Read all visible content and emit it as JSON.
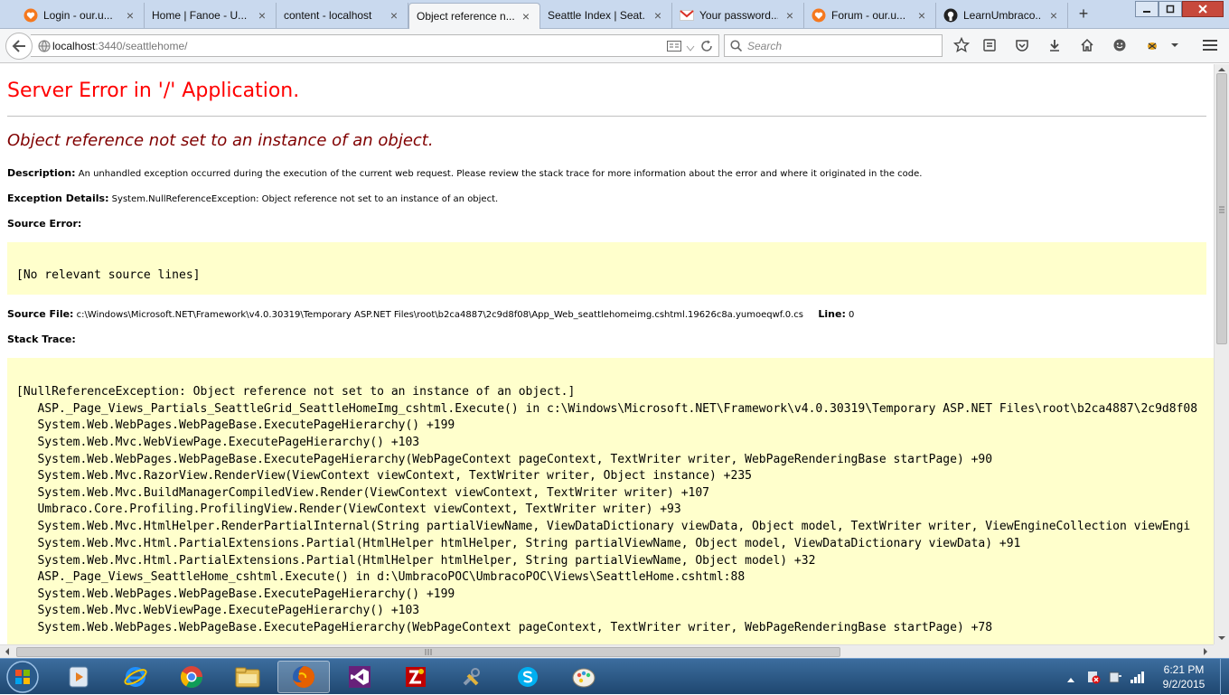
{
  "browser": {
    "tabs": [
      {
        "label": "Login - our.u...",
        "icon": "umbraco-heart-icon",
        "active": false
      },
      {
        "label": "Home | Fanoe - U...",
        "icon": "none",
        "active": false
      },
      {
        "label": "content - localhost",
        "icon": "none",
        "active": false
      },
      {
        "label": "Object reference n...",
        "icon": "none",
        "active": true
      },
      {
        "label": "Seattle Index | Seat...",
        "icon": "none",
        "active": false
      },
      {
        "label": "Your password...",
        "icon": "gmail-icon",
        "active": false
      },
      {
        "label": "Forum - our.u...",
        "icon": "umbraco-heart-icon",
        "active": false
      },
      {
        "label": "LearnUmbraco...",
        "icon": "github-icon",
        "active": false
      }
    ],
    "new_tab": "+",
    "close_glyph": "×",
    "url_host": "localhost",
    "url_path": ":3440/seattlehome/",
    "search_placeholder": "Search"
  },
  "error_page": {
    "title": "Server Error in '/' Application.",
    "message": "Object reference not set to an instance of an object.",
    "description_label": "Description:",
    "description_text": "An unhandled exception occurred during the execution of the current web request. Please review the stack trace for more information about the error and where it originated in the code.",
    "exception_label": "Exception Details:",
    "exception_text": "System.NullReferenceException: Object reference not set to an instance of an object.",
    "source_error_label": "Source Error:",
    "source_error_text": "[No relevant source lines]",
    "source_file_label": "Source File:",
    "source_file_text": "c:\\Windows\\Microsoft.NET\\Framework\\v4.0.30319\\Temporary ASP.NET Files\\root\\b2ca4887\\2c9d8f08\\App_Web_seattlehomeimg.cshtml.19626c8a.yumoeqwf.0.cs",
    "line_label": "Line:",
    "line_value": "0",
    "stack_trace_label": "Stack Trace:",
    "stack_trace_lines": [
      "[NullReferenceException: Object reference not set to an instance of an object.]",
      "   ASP._Page_Views_Partials_SeattleGrid_SeattleHomeImg_cshtml.Execute() in c:\\Windows\\Microsoft.NET\\Framework\\v4.0.30319\\Temporary ASP.NET Files\\root\\b2ca4887\\2c9d8f08",
      "   System.Web.WebPages.WebPageBase.ExecutePageHierarchy() +199",
      "   System.Web.Mvc.WebViewPage.ExecutePageHierarchy() +103",
      "   System.Web.WebPages.WebPageBase.ExecutePageHierarchy(WebPageContext pageContext, TextWriter writer, WebPageRenderingBase startPage) +90",
      "   System.Web.Mvc.RazorView.RenderView(ViewContext viewContext, TextWriter writer, Object instance) +235",
      "   System.Web.Mvc.BuildManagerCompiledView.Render(ViewContext viewContext, TextWriter writer) +107",
      "   Umbraco.Core.Profiling.ProfilingView.Render(ViewContext viewContext, TextWriter writer) +93",
      "   System.Web.Mvc.HtmlHelper.RenderPartialInternal(String partialViewName, ViewDataDictionary viewData, Object model, TextWriter writer, ViewEngineCollection viewEngi",
      "   System.Web.Mvc.Html.PartialExtensions.Partial(HtmlHelper htmlHelper, String partialViewName, Object model, ViewDataDictionary viewData) +91",
      "   System.Web.Mvc.Html.PartialExtensions.Partial(HtmlHelper htmlHelper, String partialViewName, Object model) +32",
      "   ASP._Page_Views_SeattleHome_cshtml.Execute() in d:\\UmbracoPOC\\UmbracoPOC\\Views\\SeattleHome.cshtml:88",
      "   System.Web.WebPages.WebPageBase.ExecutePageHierarchy() +199",
      "   System.Web.Mvc.WebViewPage.ExecutePageHierarchy() +103",
      "   System.Web.WebPages.WebPageBase.ExecutePageHierarchy(WebPageContext pageContext, TextWriter writer, WebPageRenderingBase startPage) +78"
    ]
  },
  "taskbar": {
    "apps": [
      "media-player-icon",
      "internet-explorer-icon",
      "chrome-icon",
      "file-explorer-icon",
      "firefox-icon",
      "visual-studio-icon",
      "filezilla-icon",
      "tools-icon",
      "skype-icon",
      "paint-icon"
    ],
    "time": "6:21 PM",
    "date": "9/2/2015"
  },
  "colors": {
    "error_title": "#ff0000",
    "error_message": "#800000",
    "code_background": "#ffffcc"
  }
}
